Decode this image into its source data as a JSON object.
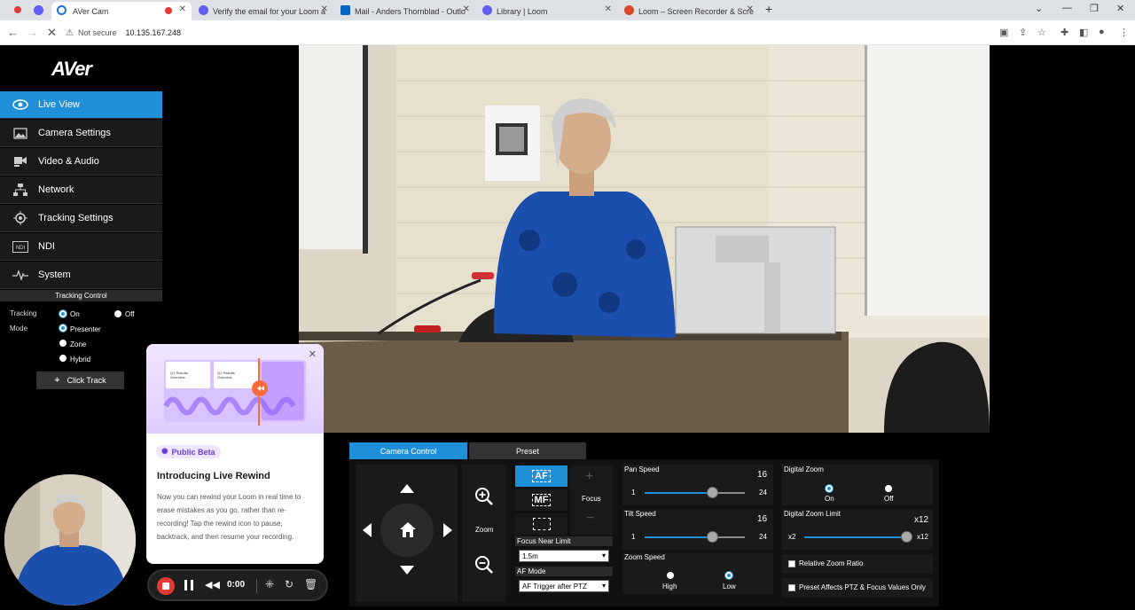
{
  "browser": {
    "tabs": [
      {
        "label": "",
        "icon": "loom-record-icon"
      },
      {
        "label": "",
        "icon": "loom-icon"
      },
      {
        "label": "AVer Cam",
        "icon": "aver-icon"
      },
      {
        "label": "Verify the email for your Loom a",
        "icon": "loom-icon"
      },
      {
        "label": "Mail - Anders Thornblad - Outlo",
        "icon": "outlook-icon"
      },
      {
        "label": "Library | Loom",
        "icon": "loom-icon"
      },
      {
        "label": "Loom – Screen Recorder & Scre",
        "icon": "loom-icon"
      }
    ],
    "security_label": "Not secure",
    "url": "10.135.167.248"
  },
  "sidebar": {
    "logo": "AVer",
    "items": [
      {
        "label": "Live View",
        "icon": "eye-icon",
        "active": true
      },
      {
        "label": "Camera Settings",
        "icon": "image-icon",
        "active": false
      },
      {
        "label": "Video & Audio",
        "icon": "video-audio-icon",
        "active": false
      },
      {
        "label": "Network",
        "icon": "network-icon",
        "active": false
      },
      {
        "label": "Tracking Settings",
        "icon": "tracking-icon",
        "active": false
      },
      {
        "label": "NDI",
        "icon": "ndi-icon",
        "active": false
      },
      {
        "label": "System",
        "icon": "system-icon",
        "active": false
      }
    ],
    "tracking_control": {
      "header": "Tracking Control",
      "tracking_label": "Tracking",
      "on_label": "On",
      "off_label": "Off",
      "mode_label": "Mode",
      "modes": [
        "Presenter",
        "Zone",
        "Hybrid"
      ],
      "selected_mode": "Presenter",
      "click_track_label": "Click Track"
    }
  },
  "camera_panel": {
    "tabs": [
      "Camera Control",
      "Preset"
    ],
    "active_tab": "Camera Control",
    "zoom_label": "Zoom",
    "focus_label": "Focus",
    "af_label": "AF",
    "mf_label": "MF",
    "focus_near_limit_label": "Focus Near Limit",
    "focus_near_limit_value": "1.5m",
    "af_mode_label": "AF Mode",
    "af_mode_value": "AF Trigger after PTZ",
    "pan_speed": {
      "label": "Pan Speed",
      "value": "16",
      "min": "1",
      "max": "24"
    },
    "tilt_speed": {
      "label": "Tilt Speed",
      "value": "16",
      "min": "1",
      "max": "24"
    },
    "zoom_speed": {
      "label": "Zoom Speed",
      "high": "High",
      "low": "Low",
      "selected": "Low"
    },
    "digital_zoom": {
      "label": "Digital Zoom",
      "on": "On",
      "off": "Off",
      "selected": "On"
    },
    "digital_zoom_limit": {
      "label": "Digital Zoom Limit",
      "value": "x12",
      "min": "x2",
      "max": "x12"
    },
    "relative_zoom_ratio_label": "Relative Zoom Ratio",
    "preset_affects_label": "Preset Affects PTZ & Focus Values Only"
  },
  "loom": {
    "badge": "Public Beta",
    "title": "Introducing Live Rewind",
    "body": "Now you can rewind your Loom in real time to erase mistakes as you go, rather than re-recording! Tap the rewind icon to pause, backtrack, and then resume your recording.",
    "timer": "0:00",
    "hero_card_1": "Q1 Results Overview",
    "hero_card_2": "Q1 Results Overview"
  }
}
